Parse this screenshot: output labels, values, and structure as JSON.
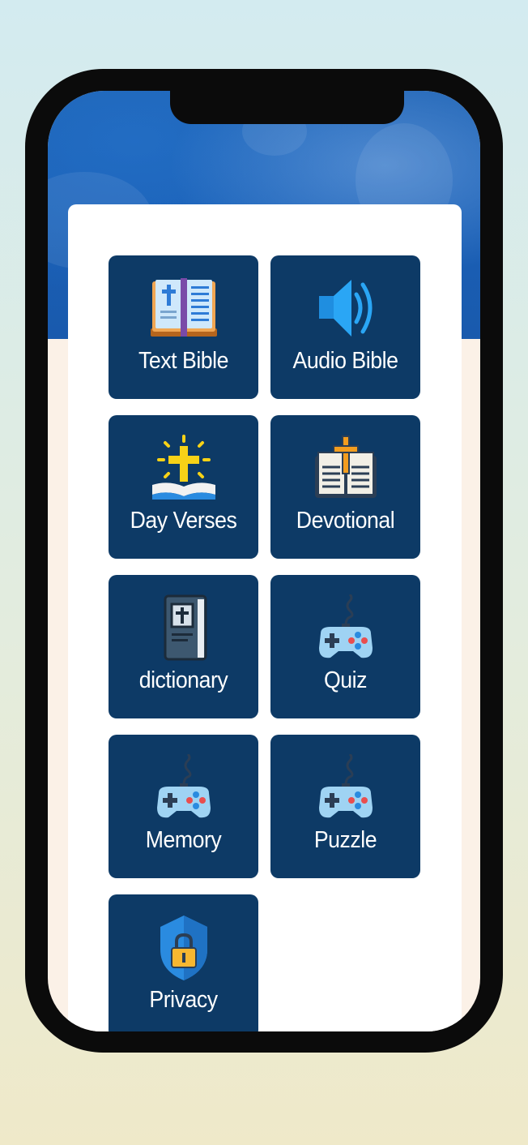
{
  "tiles": [
    {
      "label": "Text Bible",
      "icon": "bible-book-icon"
    },
    {
      "label": "Audio Bible",
      "icon": "speaker-icon"
    },
    {
      "label": "Day Verses",
      "icon": "glowing-cross-book-icon"
    },
    {
      "label": "Devotional",
      "icon": "open-book-cross-icon"
    },
    {
      "label": "dictionary",
      "icon": "cross-book-icon"
    },
    {
      "label": "Quiz",
      "icon": "gamepad-icon"
    },
    {
      "label": "Memory",
      "icon": "gamepad-icon"
    },
    {
      "label": "Puzzle",
      "icon": "gamepad-icon"
    },
    {
      "label": "Privacy",
      "icon": "shield-lock-icon"
    }
  ],
  "colors": {
    "tile_background": "#0d3a66",
    "card_background": "#ffffff",
    "header_blue": "#1a5fb5",
    "screen_background": "#fbf1e7"
  }
}
